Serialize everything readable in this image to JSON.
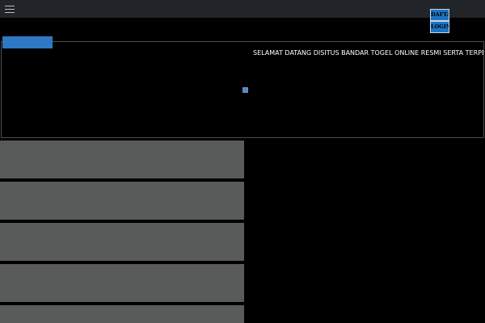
{
  "header": {
    "menu_icon": "hamburger-menu-icon",
    "background": "#212529"
  },
  "auth": {
    "daftar_label": "DAFTAR",
    "login_label": "LOGIN",
    "button_color": "#1f73c4"
  },
  "hero": {
    "marquee_text": "SELAMAT DATANG DISITUS BANDAR TOGEL ONLINE RESMI SERTA TERPERCAYA JULIATOTO",
    "image_icon": "broken-image-icon",
    "accent_bar_color": "#2f78c4"
  },
  "panels": {
    "color": "#595a5a"
  }
}
